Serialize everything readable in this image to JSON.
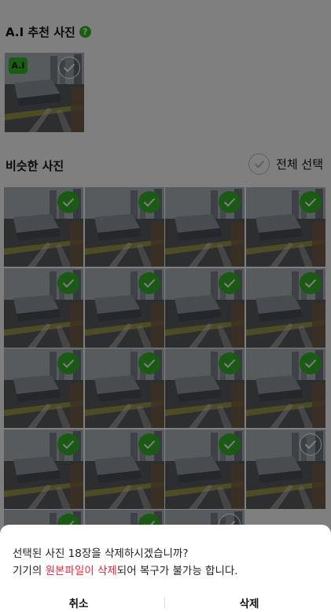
{
  "ai_section": {
    "title": "A.I 추천 사진",
    "help_icon": "question-circle-icon",
    "badge": "A.I"
  },
  "similar_section": {
    "title": "비슷한 사진",
    "select_all_label": "전체 선택"
  },
  "photo_grid": {
    "count_visible": 19,
    "selected_flags": [
      true,
      true,
      true,
      true,
      true,
      true,
      true,
      true,
      true,
      true,
      true,
      true,
      true,
      true,
      true,
      false,
      true,
      true,
      false
    ]
  },
  "dialog": {
    "line1": "선택된 사진 18장을 삭제하시겠습니까?",
    "line2_prefix": "기기의 ",
    "line2_highlight": "원본파일이 삭제",
    "line2_suffix": "되어 복구가 불가능 합니다.",
    "cancel_label": "취소",
    "delete_label": "삭제"
  },
  "colors": {
    "accent_green": "#36b52a",
    "warning_red": "#e8263d"
  }
}
